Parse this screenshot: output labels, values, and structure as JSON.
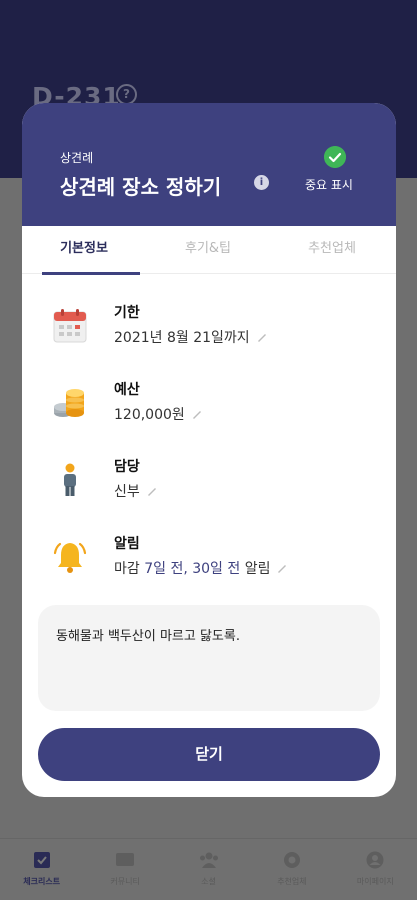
{
  "background": {
    "dday": "D-231",
    "help_icon": "question-circle-icon",
    "tabbar": [
      {
        "label": "체크리스트",
        "icon": "checklist-icon",
        "active": true
      },
      {
        "label": "커뮤니티",
        "icon": "chat-icon",
        "active": false
      },
      {
        "label": "소셜",
        "icon": "people-icon",
        "active": false
      },
      {
        "label": "추천업체",
        "icon": "store-icon",
        "active": false
      },
      {
        "label": "마이페이지",
        "icon": "person-icon",
        "active": false
      }
    ]
  },
  "modal": {
    "subtitle": "상견례",
    "title": "상견례 장소 정하기",
    "important_label": "중요 표시",
    "tabs": [
      "기본정보",
      "후기&팁",
      "추천업체"
    ],
    "active_tab": 0,
    "rows": [
      {
        "label": "기한",
        "value": "2021년 8월 21일까지",
        "icon": "calendar-icon"
      },
      {
        "label": "예산",
        "value": "120,000원",
        "icon": "coins-icon"
      },
      {
        "label": "담당",
        "value": "신부",
        "icon": "person-icon"
      },
      {
        "label": "알림",
        "value_prefix": "마감 ",
        "value_accent": "7일 전, 30일 전",
        "value_suffix": " 알림",
        "icon": "bell-icon"
      }
    ],
    "memo": "동해물과 백두산이 마르고 닳도록.",
    "close_label": "닫기"
  },
  "colors": {
    "header_bg": "#3e417f",
    "accent": "#3e417f",
    "check_green": "#3fb657",
    "dark_bg": "#1f2046"
  }
}
